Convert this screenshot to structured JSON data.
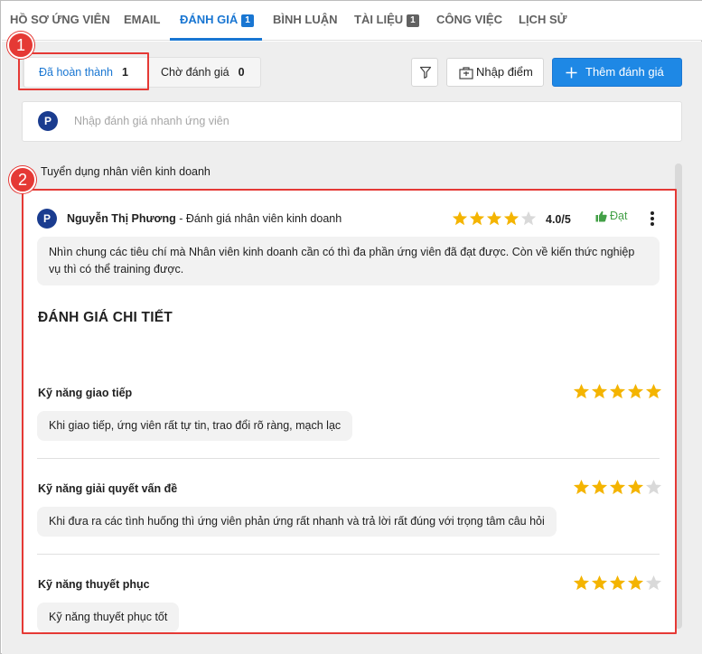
{
  "tabs": [
    {
      "label": "HỒ SƠ ỨNG VIÊN"
    },
    {
      "label": "EMAIL"
    },
    {
      "label": "ĐÁNH GIÁ",
      "count": "1"
    },
    {
      "label": "BÌNH LUẬN"
    },
    {
      "label": "TÀI LIỆU",
      "count": "1"
    },
    {
      "label": "CÔNG VIỆC"
    },
    {
      "label": "LỊCH SỬ"
    }
  ],
  "filters": {
    "completed_label": "Đã hoàn thành",
    "completed_count": "1",
    "pending_label": "Chờ đánh giá",
    "pending_count": "0"
  },
  "toolbar": {
    "filter_icon": "filter-icon",
    "import_label": "Nhập điểm",
    "add_label": "Thêm đánh giá"
  },
  "quick_input": {
    "avatar": "P",
    "placeholder": "Nhập đánh giá nhanh ứng viên"
  },
  "annotations": {
    "badge_1": "1",
    "badge_2": "2",
    "color": "#e53935"
  },
  "group_title": "Tuyển dụng nhân viên kinh doanh",
  "review": {
    "avatar": "P",
    "reviewer": "Nguyễn Thị Phương",
    "form_name": " - Đánh giá nhân viên kinh doanh",
    "rating": 4,
    "max_rating": 5,
    "score_label": "4.0/5",
    "result": "Đạt",
    "summary": "Nhìn chung các tiêu chí mà Nhân viên kinh doanh cần có thì đa phần ứng viên đã đạt được. Còn về kiến thức nghiệp vụ thì có thể training được."
  },
  "detail": {
    "title": "ĐÁNH GIÁ CHI TIẾT",
    "criteria": [
      {
        "name": "Kỹ năng giao tiếp",
        "rating": 5,
        "comment": "Khi giao tiếp, ứng viên rất tự tin, trao đổi rõ ràng, mạch lạc"
      },
      {
        "name": "Kỹ năng giải quyết vấn đề",
        "rating": 4,
        "comment": "Khi đưa ra các tình huống thì ứng viên phản ứng rất nhanh và trả lời rất đúng với trọng tâm câu hỏi"
      },
      {
        "name": "Kỹ năng thuyết phục",
        "rating": 4,
        "comment": "Kỹ năng thuyết phục tốt"
      }
    ]
  },
  "colors": {
    "accent": "#1976d2",
    "star": "#f4b400",
    "star_empty": "#d9d9d9",
    "pass": "#43a047",
    "highlight": "#e53935"
  }
}
